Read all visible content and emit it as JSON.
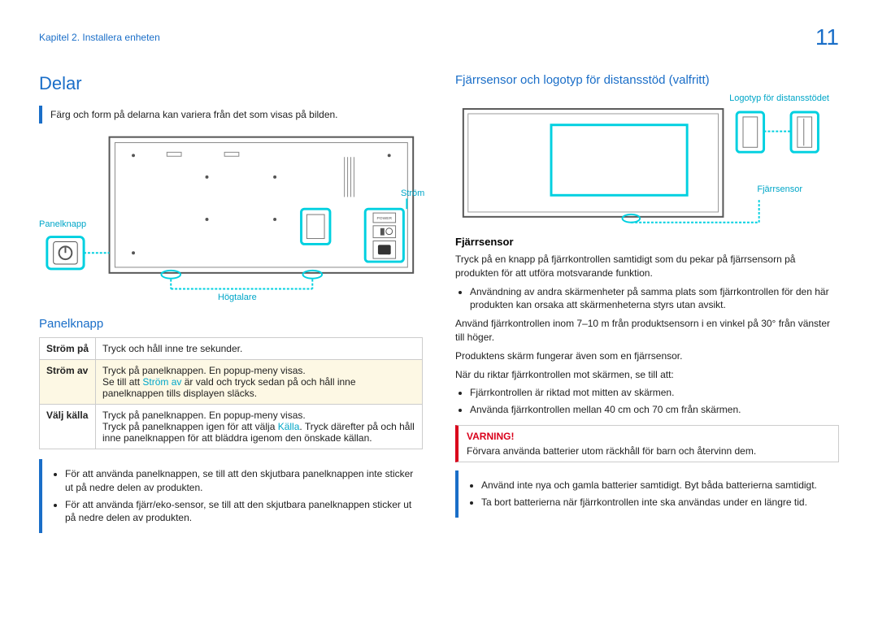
{
  "header": {
    "chapter": "Kapitel 2. Installera enheten",
    "page": "11"
  },
  "left": {
    "heading": "Delar",
    "intro_note": "Färg och form på delarna kan variera från det som visas på bilden.",
    "diagram_labels": {
      "panel_button": "Panelknapp",
      "speaker": "Högtalare",
      "power": "Ström"
    },
    "panel_heading": "Panelknapp",
    "table": {
      "r1c1": "Ström på",
      "r1c2": "Tryck och håll inne tre sekunder.",
      "r2c1": "Ström av",
      "r2c2a": "Tryck på panelknappen. En popup-meny visas.",
      "r2c2b_pre": "Se till att ",
      "r2c2b_cyan": "Ström av",
      "r2c2b_post": " är vald och tryck sedan på och håll inne panelknappen tills displayen släcks.",
      "r3c1": "Välj källa",
      "r3c2a": "Tryck på panelknappen. En popup-meny visas.",
      "r3c2b_pre": "Tryck på panelknappen igen för att välja ",
      "r3c2b_cyan": "Källa",
      "r3c2b_post": ". Tryck därefter på och håll inne panelknappen för att bläddra igenom den önskade källan."
    },
    "bottom_bullets": [
      "För att använda panelknappen, se till att den skjutbara panelknappen inte sticker ut på nedre delen av produkten.",
      "För att använda fjärr/eko-sensor, se till att den skjutbara panelknappen sticker ut på nedre delen av produkten."
    ]
  },
  "right": {
    "heading": "Fjärrsensor och logotyp för distansstöd (valfritt)",
    "diagram_labels": {
      "logo": "Logotyp för distansstödet",
      "sensor": "Fjärrsensor"
    },
    "sensor_heading": "Fjärrsensor",
    "p1": "Tryck på en knapp på fjärrkontrollen samtidigt som du pekar på fjärrsensorn på produkten för att utföra motsvarande funktion.",
    "b1": "Användning av andra skärmenheter på samma plats som fjärrkontrollen för den här produkten kan orsaka att skärmenheterna styrs utan avsikt.",
    "p2": "Använd fjärrkontrollen inom 7–10 m från produktsensorn i en vinkel på 30° från vänster till höger.",
    "p3": "Produktens skärm fungerar även som en fjärrsensor.",
    "p4": "När du riktar fjärrkontrollen mot skärmen, se till att:",
    "b2": [
      "Fjärrkontrollen är riktad mot mitten av skärmen.",
      "Använda fjärrkontrollen mellan 40 cm och 70 cm från skärmen."
    ],
    "warning_title": "VARNING!",
    "warning_body": "Förvara använda batterier utom räckhåll för barn och återvinn dem.",
    "b3": [
      "Använd inte nya och gamla batterier samtidigt. Byt båda batterierna samtidigt.",
      "Ta bort batterierna när fjärrkontrollen inte ska användas under en längre tid."
    ]
  }
}
